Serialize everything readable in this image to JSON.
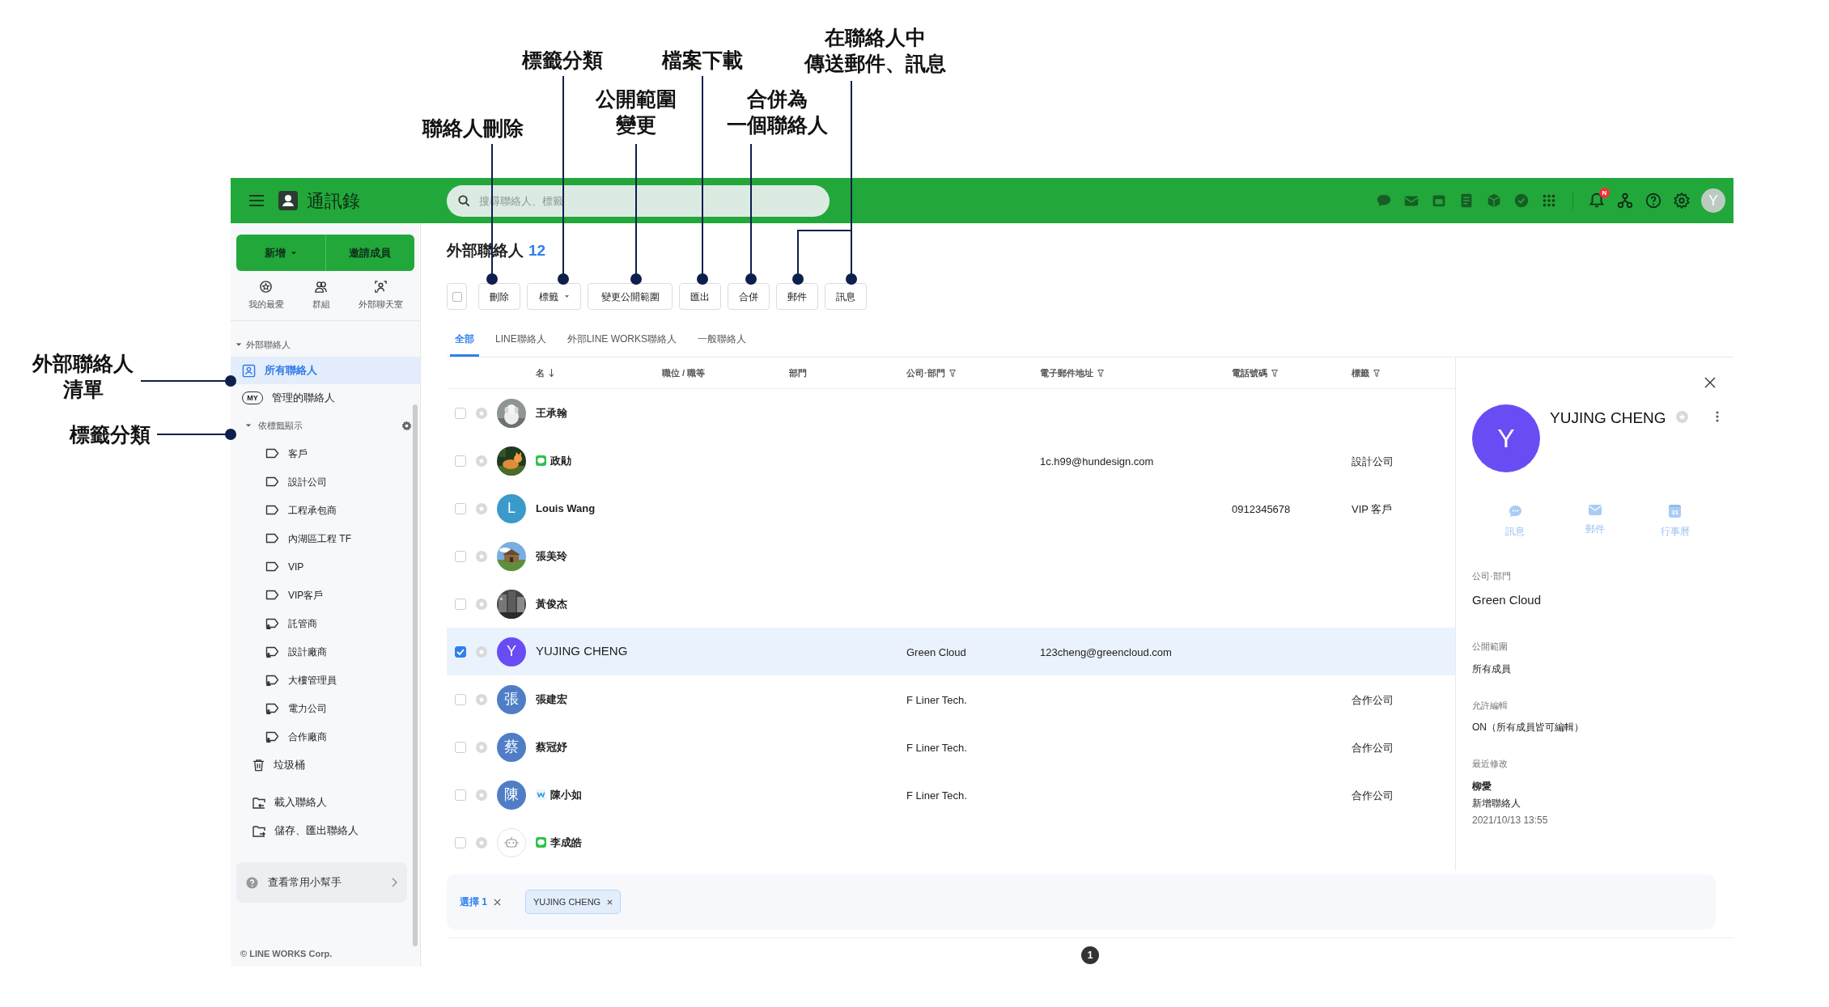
{
  "annotations": [
    {
      "lines": [
        "聯絡人刪除"
      ]
    },
    {
      "lines": [
        "標籤分類"
      ]
    },
    {
      "lines": [
        "公開範圍",
        "變更"
      ]
    },
    {
      "lines": [
        "檔案下載"
      ]
    },
    {
      "lines": [
        "合併為",
        "一個聯絡人"
      ]
    },
    {
      "lines": [
        "在聯絡人中",
        "傳送郵件、訊息"
      ]
    },
    {
      "lines": [
        "外部聯絡人",
        "清單"
      ]
    },
    {
      "lines": [
        "標籤分類"
      ]
    }
  ],
  "header": {
    "title": "通訊錄",
    "search": {
      "placeholder": "搜尋聯絡人、標籤"
    },
    "notification_badge": "N",
    "avatar": "Y"
  },
  "sidebar": {
    "buttons": [
      {
        "label": "新增",
        "dropdown": true
      },
      {
        "label": "邀請成員",
        "dropdown": false
      }
    ],
    "shortcuts": [
      {
        "label": "我的最愛",
        "kind": "favorite"
      },
      {
        "label": "群組",
        "kind": "group"
      },
      {
        "label": "外部聊天室",
        "kind": "chat"
      }
    ],
    "section": {
      "label": "外部聯絡人",
      "expanded": true
    },
    "items": [
      {
        "label": "所有聯絡人",
        "selected": true,
        "kind": "card"
      },
      {
        "label": "管理的聯絡人",
        "selected": false,
        "kind": "badge",
        "badge": "MY"
      }
    ],
    "tag_group": {
      "label": "依標籤顯示",
      "expanded": true,
      "children": [
        {
          "label": "客戶",
          "kind": "tag"
        },
        {
          "label": "設計公司",
          "kind": "tag"
        },
        {
          "label": "工程承包商",
          "kind": "tag"
        },
        {
          "label": "內湖區工程 TF",
          "kind": "tag"
        },
        {
          "label": "VIP",
          "kind": "tag"
        },
        {
          "label": "VIP客戶",
          "kind": "tag"
        },
        {
          "label": "託管商",
          "kind": "shared"
        },
        {
          "label": "設計廠商",
          "kind": "shared"
        },
        {
          "label": "大樓管理員",
          "kind": "shared"
        },
        {
          "label": "電力公司",
          "kind": "shared"
        },
        {
          "label": "合作廠商",
          "kind": "shared"
        }
      ]
    },
    "trash": "垃圾桶",
    "actions": [
      {
        "label": "載入聯絡人",
        "kind": "import"
      },
      {
        "label": "儲存、匯出聯絡人",
        "kind": "export"
      }
    ],
    "helper": "查看常用小幫手",
    "footer": "© LINE WORKS Corp."
  },
  "main": {
    "title": "外部聯絡人",
    "count": "12",
    "toolbar": {
      "select_all_checked": false,
      "buttons": [
        {
          "label": "刪除",
          "dropdown": false
        },
        {
          "label": "標籤",
          "dropdown": true
        },
        {
          "label": "變更公開範圍",
          "dropdown": false
        },
        {
          "label": "匯出",
          "dropdown": false
        },
        {
          "label": "合併",
          "dropdown": false
        },
        {
          "label": "郵件",
          "dropdown": false
        },
        {
          "label": "訊息",
          "dropdown": false
        }
      ]
    },
    "tabs": [
      {
        "label": "全部",
        "selected": true
      },
      {
        "label": "LINE聯絡人",
        "selected": false
      },
      {
        "label": "外部LINE WORKS聯絡人",
        "selected": false
      },
      {
        "label": "一般聯絡人",
        "selected": false
      }
    ],
    "table": {
      "columns": [
        {
          "label": "名",
          "kind": "sort"
        },
        {
          "label": "職位 / 職等",
          "kind": "plain"
        },
        {
          "label": "部門",
          "kind": "plain"
        },
        {
          "label": "公司·部門",
          "kind": "filter"
        },
        {
          "label": "電子郵件地址",
          "kind": "filter"
        },
        {
          "label": "電話號碼",
          "kind": "filter"
        },
        {
          "label": "標籤",
          "kind": "filter"
        }
      ],
      "rows": [
        {
          "name": "王承翰",
          "kind": "plain",
          "checked": false
        },
        {
          "name": "政勛",
          "kind": "line",
          "checked": false,
          "email": "1c.h99@hundesign.com",
          "tag": "設計公司"
        },
        {
          "name": "Louis Wang",
          "kind": "plain",
          "checked": false,
          "avatar": {
            "kind": "letter",
            "letter": "L",
            "color": "#3a9ac9"
          },
          "phone": "0912345678",
          "tag": "VIP 客戶"
        },
        {
          "name": "張美玲",
          "kind": "plain",
          "checked": false
        },
        {
          "name": "黃俊杰",
          "kind": "plain",
          "checked": false
        },
        {
          "name": "YUJING CHENG",
          "kind": "plain",
          "checked": true,
          "avatar": {
            "kind": "letter",
            "letter": "Y",
            "color": "#6a4cf5"
          },
          "company": "Green Cloud",
          "email": "123cheng@greencloud.com"
        },
        {
          "name": "張建宏",
          "kind": "plain",
          "checked": false,
          "avatar": {
            "kind": "letter",
            "letter": "張",
            "color": "#4f7ec6"
          },
          "company": "F Liner Tech.",
          "tag": "合作公司"
        },
        {
          "name": "蔡冠妤",
          "kind": "plain",
          "checked": false,
          "avatar": {
            "kind": "letter",
            "letter": "蔡",
            "color": "#4f7ec6"
          },
          "company": "F Liner Tech.",
          "tag": "合作公司"
        },
        {
          "name": "陳小如",
          "kind": "lineworks",
          "checked": false,
          "avatar": {
            "kind": "letter",
            "letter": "陳",
            "color": "#4f7ec6"
          },
          "company": "F Liner Tech.",
          "tag": "合作公司"
        },
        {
          "name": "李成皓",
          "kind": "line",
          "checked": false,
          "avatar": {
            "kind": "default"
          }
        }
      ]
    }
  },
  "panel": {
    "avatar": "Y",
    "name": "YUJING CHENG",
    "actions": [
      {
        "label": "訊息",
        "kind": "chat"
      },
      {
        "label": "郵件",
        "kind": "mail"
      },
      {
        "label": "行事曆",
        "kind": "calendar",
        "day": "31"
      }
    ],
    "fields": [
      {
        "label": "公司·部門",
        "value": "Green Cloud"
      },
      {
        "label": "公開範圍",
        "value": "所有成員"
      },
      {
        "label": "允許編輯",
        "value": "ON（所有成員皆可編輯）"
      }
    ],
    "last_modified": {
      "label": "最近修改",
      "by": "柳愛",
      "action": "新增聯絡人",
      "time": "2021/10/13 13:55"
    }
  },
  "selection": {
    "label": "選擇 1",
    "chips": [
      "YUJING CHENG"
    ]
  },
  "pagination": [
    {
      "label": "1",
      "selected": true
    }
  ]
}
